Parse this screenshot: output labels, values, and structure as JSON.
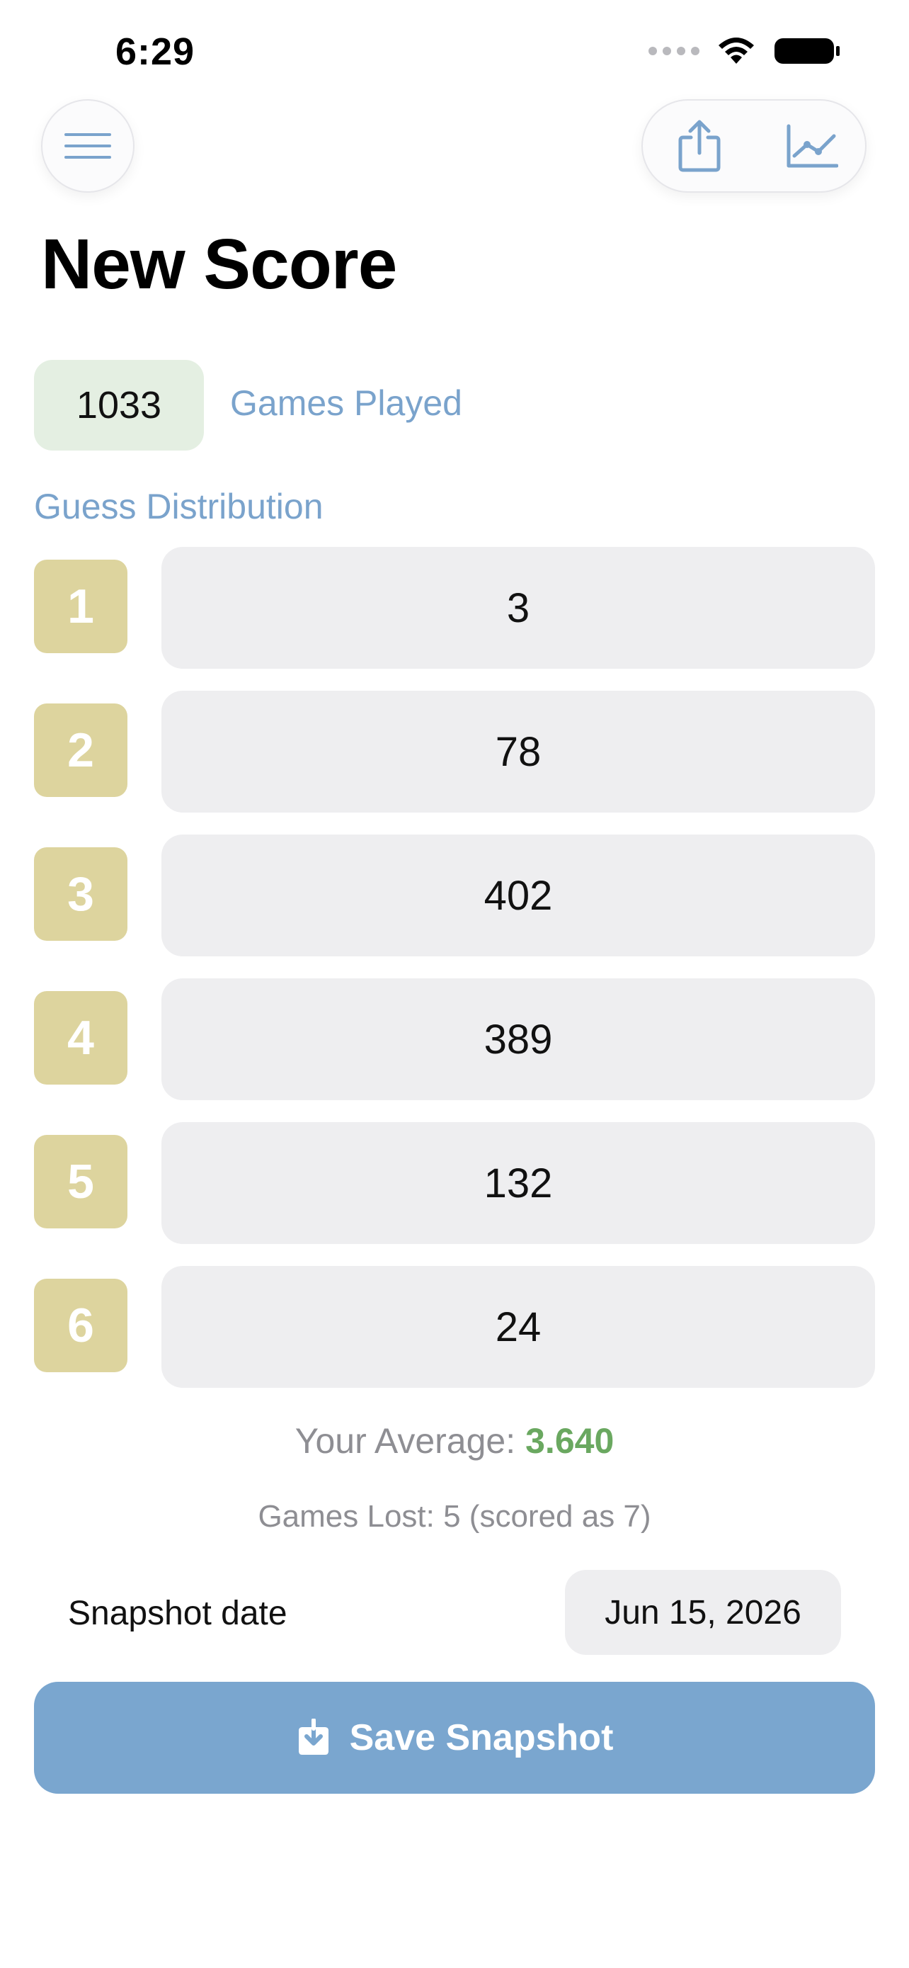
{
  "status_bar": {
    "time": "6:29"
  },
  "toolbar": {
    "menu_icon": "hamburger-menu-icon",
    "share_icon": "share-icon",
    "stats_icon": "line-chart-icon"
  },
  "page": {
    "title": "New Score"
  },
  "games_played": {
    "value": "1033",
    "label": "Games Played"
  },
  "distribution": {
    "heading": "Guess Distribution",
    "rows": [
      {
        "guess": "1",
        "value": "3"
      },
      {
        "guess": "2",
        "value": "78"
      },
      {
        "guess": "3",
        "value": "402"
      },
      {
        "guess": "4",
        "value": "389"
      },
      {
        "guess": "5",
        "value": "132"
      },
      {
        "guess": "6",
        "value": "24"
      }
    ]
  },
  "average": {
    "label": "Your Average:",
    "value": "3.640"
  },
  "games_lost": {
    "text": "Games Lost: 5 (scored as 7)"
  },
  "snapshot": {
    "label": "Snapshot date",
    "date": "Jun 15, 2026"
  },
  "save_button": {
    "label": "Save Snapshot",
    "icon": "save-download-icon"
  },
  "colors": {
    "accent": "#7aa6cf",
    "guess_badge": "#ddd49e",
    "games_badge": "#e4efe2",
    "average_value": "#6aa860",
    "value_field": "#eeeef0"
  }
}
